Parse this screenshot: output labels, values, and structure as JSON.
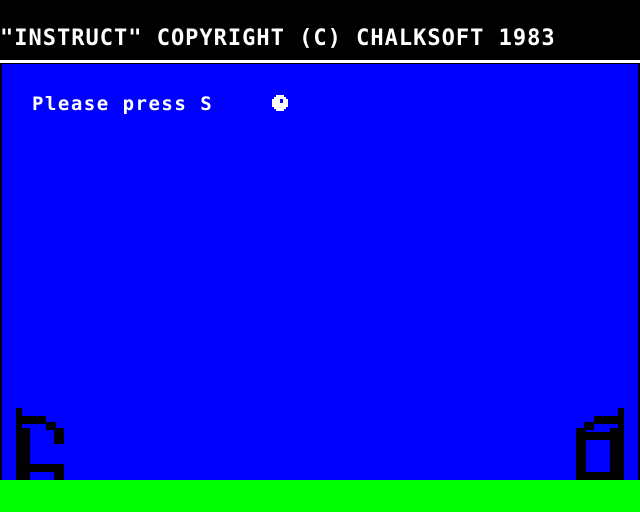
{
  "header": {
    "title": "\"INSTRUCT\" COPYRIGHT (C) CHALKSOFT 1983"
  },
  "screen": {
    "prompt": "Please press S"
  },
  "colors": {
    "background": "#000000",
    "play_area": "#0000ff",
    "ground": "#00ff00",
    "text": "#ffffff",
    "posts": "#000000"
  },
  "icons": {
    "cursor": "ball-icon",
    "left_post": "left-goalpost-icon",
    "right_post": "right-goalpost-icon"
  }
}
